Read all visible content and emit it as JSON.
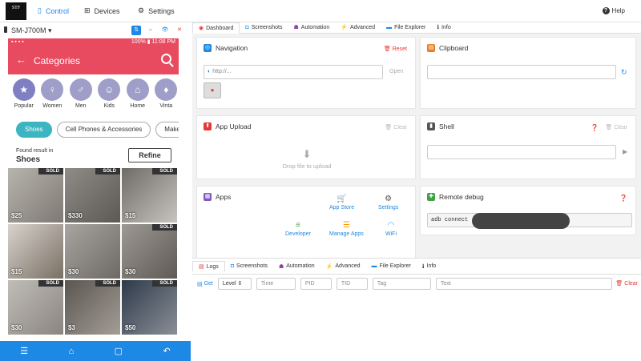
{
  "topbar": {
    "logo_text": "STF",
    "nav": [
      {
        "label": "Control",
        "icon": "phone-icon",
        "active": true
      },
      {
        "label": "Devices",
        "icon": "sitemap-icon",
        "active": false
      },
      {
        "label": "Settings",
        "icon": "gears-icon",
        "active": false
      }
    ],
    "help_label": "Help"
  },
  "device": {
    "name": "SM-J700M",
    "status_right": "100% ▮ 11:08 PM",
    "app_title": "Categories",
    "categories": [
      "Popular",
      "Women",
      "Men",
      "Kids",
      "Home",
      "Vinta"
    ],
    "chips": [
      "Shoes",
      "Cell Phones & Accessories",
      "Make"
    ],
    "found_label": "Found result in",
    "found_term": "Shoes",
    "refine_label": "Refine",
    "tiles": [
      {
        "price": "$25",
        "sold": true
      },
      {
        "price": "$330",
        "sold": true
      },
      {
        "price": "$15",
        "sold": true
      },
      {
        "price": "$15",
        "sold": false
      },
      {
        "price": "$30",
        "sold": false
      },
      {
        "price": "$30",
        "sold": true
      },
      {
        "price": "$30",
        "sold": true
      },
      {
        "price": "$3",
        "sold": true
      },
      {
        "price": "$50",
        "sold": true
      }
    ],
    "sold_label": "SOLD",
    "colors": {
      "accent": "#e84a5f",
      "chip": "#3bb5c1",
      "nav": "#1e88e5"
    }
  },
  "tabs": [
    "Dashboard",
    "Screenshots",
    "Automation",
    "Advanced",
    "File Explorer",
    "Info"
  ],
  "panels": {
    "navigation": {
      "title": "Navigation",
      "reset": "Reset",
      "placeholder": "http://...",
      "open": "Open"
    },
    "clipboard": {
      "title": "Clipboard"
    },
    "upload": {
      "title": "App Upload",
      "clear": "Clear",
      "drop": "Drop file to upload"
    },
    "shell": {
      "title": "Shell",
      "clear": "Clear"
    },
    "apps": {
      "title": "Apps",
      "items": [
        "App Store",
        "Settings",
        "Developer",
        "Manage Apps",
        "WiFi"
      ]
    },
    "remote": {
      "title": "Remote debug",
      "cmd": "adb connect"
    }
  },
  "logs": {
    "tabs": [
      "Logs",
      "Screenshots",
      "Automation",
      "Advanced",
      "File Explorer",
      "Info"
    ],
    "get": "Get",
    "level": "Level",
    "fields": [
      "Time",
      "PID",
      "TID",
      "Tag",
      "Text"
    ],
    "clear": "Clear"
  }
}
